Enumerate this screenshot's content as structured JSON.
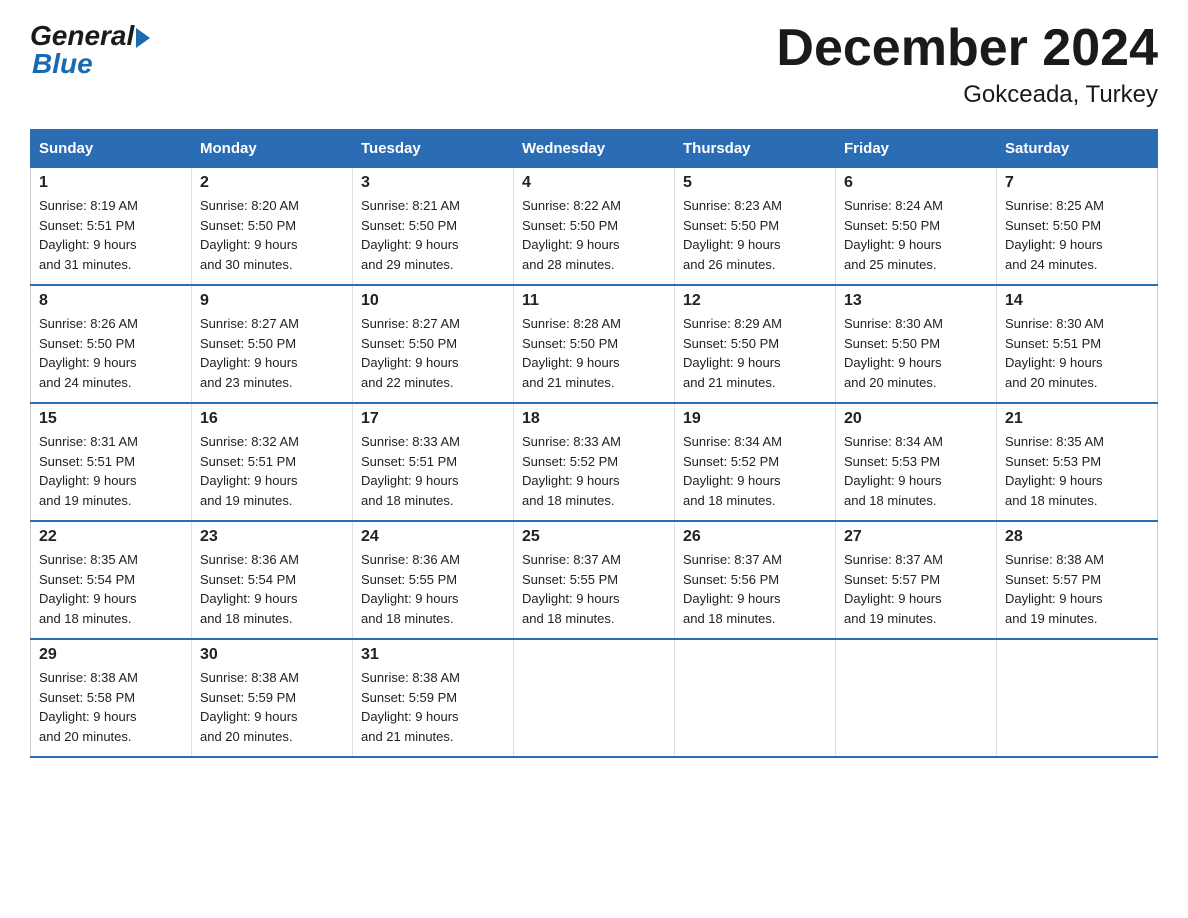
{
  "logo": {
    "general": "General",
    "blue": "Blue"
  },
  "title": "December 2024",
  "subtitle": "Gokceada, Turkey",
  "weekdays": [
    "Sunday",
    "Monday",
    "Tuesday",
    "Wednesday",
    "Thursday",
    "Friday",
    "Saturday"
  ],
  "weeks": [
    [
      {
        "day": "1",
        "sunrise": "8:19 AM",
        "sunset": "5:51 PM",
        "daylight": "9 hours and 31 minutes."
      },
      {
        "day": "2",
        "sunrise": "8:20 AM",
        "sunset": "5:50 PM",
        "daylight": "9 hours and 30 minutes."
      },
      {
        "day": "3",
        "sunrise": "8:21 AM",
        "sunset": "5:50 PM",
        "daylight": "9 hours and 29 minutes."
      },
      {
        "day": "4",
        "sunrise": "8:22 AM",
        "sunset": "5:50 PM",
        "daylight": "9 hours and 28 minutes."
      },
      {
        "day": "5",
        "sunrise": "8:23 AM",
        "sunset": "5:50 PM",
        "daylight": "9 hours and 26 minutes."
      },
      {
        "day": "6",
        "sunrise": "8:24 AM",
        "sunset": "5:50 PM",
        "daylight": "9 hours and 25 minutes."
      },
      {
        "day": "7",
        "sunrise": "8:25 AM",
        "sunset": "5:50 PM",
        "daylight": "9 hours and 24 minutes."
      }
    ],
    [
      {
        "day": "8",
        "sunrise": "8:26 AM",
        "sunset": "5:50 PM",
        "daylight": "9 hours and 24 minutes."
      },
      {
        "day": "9",
        "sunrise": "8:27 AM",
        "sunset": "5:50 PM",
        "daylight": "9 hours and 23 minutes."
      },
      {
        "day": "10",
        "sunrise": "8:27 AM",
        "sunset": "5:50 PM",
        "daylight": "9 hours and 22 minutes."
      },
      {
        "day": "11",
        "sunrise": "8:28 AM",
        "sunset": "5:50 PM",
        "daylight": "9 hours and 21 minutes."
      },
      {
        "day": "12",
        "sunrise": "8:29 AM",
        "sunset": "5:50 PM",
        "daylight": "9 hours and 21 minutes."
      },
      {
        "day": "13",
        "sunrise": "8:30 AM",
        "sunset": "5:50 PM",
        "daylight": "9 hours and 20 minutes."
      },
      {
        "day": "14",
        "sunrise": "8:30 AM",
        "sunset": "5:51 PM",
        "daylight": "9 hours and 20 minutes."
      }
    ],
    [
      {
        "day": "15",
        "sunrise": "8:31 AM",
        "sunset": "5:51 PM",
        "daylight": "9 hours and 19 minutes."
      },
      {
        "day": "16",
        "sunrise": "8:32 AM",
        "sunset": "5:51 PM",
        "daylight": "9 hours and 19 minutes."
      },
      {
        "day": "17",
        "sunrise": "8:33 AM",
        "sunset": "5:51 PM",
        "daylight": "9 hours and 18 minutes."
      },
      {
        "day": "18",
        "sunrise": "8:33 AM",
        "sunset": "5:52 PM",
        "daylight": "9 hours and 18 minutes."
      },
      {
        "day": "19",
        "sunrise": "8:34 AM",
        "sunset": "5:52 PM",
        "daylight": "9 hours and 18 minutes."
      },
      {
        "day": "20",
        "sunrise": "8:34 AM",
        "sunset": "5:53 PM",
        "daylight": "9 hours and 18 minutes."
      },
      {
        "day": "21",
        "sunrise": "8:35 AM",
        "sunset": "5:53 PM",
        "daylight": "9 hours and 18 minutes."
      }
    ],
    [
      {
        "day": "22",
        "sunrise": "8:35 AM",
        "sunset": "5:54 PM",
        "daylight": "9 hours and 18 minutes."
      },
      {
        "day": "23",
        "sunrise": "8:36 AM",
        "sunset": "5:54 PM",
        "daylight": "9 hours and 18 minutes."
      },
      {
        "day": "24",
        "sunrise": "8:36 AM",
        "sunset": "5:55 PM",
        "daylight": "9 hours and 18 minutes."
      },
      {
        "day": "25",
        "sunrise": "8:37 AM",
        "sunset": "5:55 PM",
        "daylight": "9 hours and 18 minutes."
      },
      {
        "day": "26",
        "sunrise": "8:37 AM",
        "sunset": "5:56 PM",
        "daylight": "9 hours and 18 minutes."
      },
      {
        "day": "27",
        "sunrise": "8:37 AM",
        "sunset": "5:57 PM",
        "daylight": "9 hours and 19 minutes."
      },
      {
        "day": "28",
        "sunrise": "8:38 AM",
        "sunset": "5:57 PM",
        "daylight": "9 hours and 19 minutes."
      }
    ],
    [
      {
        "day": "29",
        "sunrise": "8:38 AM",
        "sunset": "5:58 PM",
        "daylight": "9 hours and 20 minutes."
      },
      {
        "day": "30",
        "sunrise": "8:38 AM",
        "sunset": "5:59 PM",
        "daylight": "9 hours and 20 minutes."
      },
      {
        "day": "31",
        "sunrise": "8:38 AM",
        "sunset": "5:59 PM",
        "daylight": "9 hours and 21 minutes."
      },
      null,
      null,
      null,
      null
    ]
  ],
  "labels": {
    "sunrise": "Sunrise:",
    "sunset": "Sunset:",
    "daylight": "Daylight:"
  }
}
